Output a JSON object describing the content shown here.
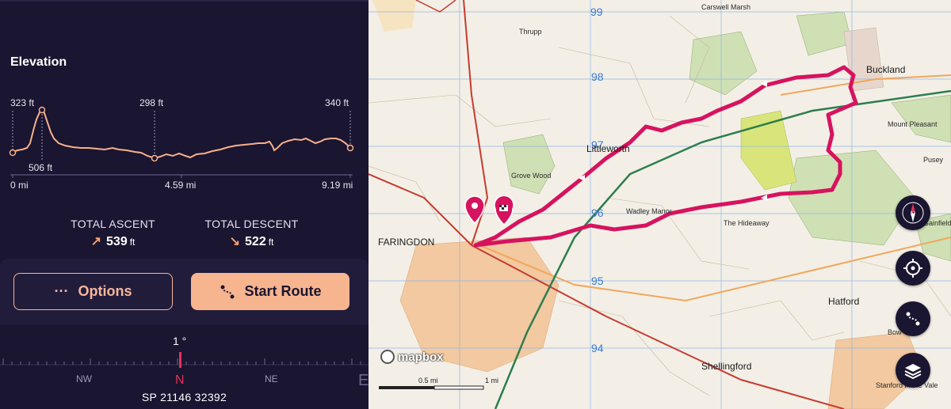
{
  "elevation": {
    "title": "Elevation",
    "labels": {
      "start_ft": "323 ft",
      "peak_ft": "506 ft",
      "mid_ft": "298 ft",
      "end_ft": "340 ft"
    },
    "x_axis": {
      "start": "0 mi",
      "mid": "4.59 mi",
      "end": "9.19 mi"
    }
  },
  "stats": {
    "ascent_label": "TOTAL ASCENT",
    "ascent_value": "539",
    "ascent_unit": "ft",
    "descent_label": "TOTAL DESCENT",
    "descent_value": "522",
    "descent_unit": "ft"
  },
  "actions": {
    "options_label": "Options",
    "start_label": "Start Route"
  },
  "compass": {
    "bearing": "1 °",
    "labels": [
      "NW",
      "N",
      "NE",
      "E"
    ],
    "grid_reference": "SP 21146 32392"
  },
  "map": {
    "attribution": "mapbox",
    "scale_labels": [
      "0.5 mi",
      "1 mi"
    ],
    "place_labels": {
      "faringdon": "FARINGDON",
      "buckland": "Buckland",
      "hatford": "Hatford",
      "shellingford": "Shellingford",
      "littleworth": "Littleworth",
      "carswell_marsh": "Carswell Marsh",
      "thrupp": "Thrupp",
      "pusey": "Pusey",
      "bow": "Bow",
      "stanford": "Stanford in the Vale",
      "gainfield": "Gainfield",
      "grove_wood": "Grove Wood",
      "the_hideaway": "The Hideaway",
      "mount_pleasant": "Mount Pleasant",
      "wadley_manor": "Wadley Manor"
    },
    "grid_numbers": [
      "99",
      "98",
      "97",
      "96",
      "95",
      "94"
    ],
    "colors": {
      "route": "#d6135f",
      "road_green": "#2e7d4f"
    }
  }
}
